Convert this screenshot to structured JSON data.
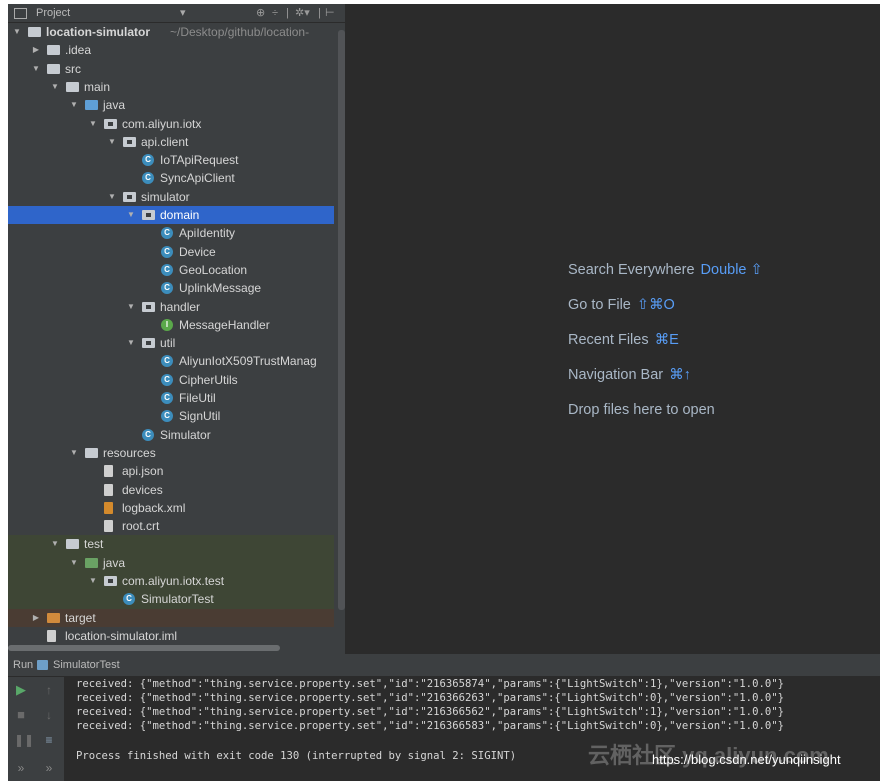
{
  "project_header": {
    "title": "Project",
    "dropdown_icon": "▾",
    "icons": [
      "target-icon",
      "split-icon",
      "gear-icon",
      "hide-icon"
    ]
  },
  "tree": [
    {
      "label": "location-simulator",
      "suffix": "~/Desktop/github/location-",
      "indent": 0,
      "toggle": "▼",
      "icon": "folder",
      "bold": true
    },
    {
      "label": ".idea",
      "indent": 1,
      "toggle": "▶",
      "icon": "folder"
    },
    {
      "label": "src",
      "indent": 1,
      "toggle": "▼",
      "icon": "folder"
    },
    {
      "label": "main",
      "indent": 2,
      "toggle": "▼",
      "icon": "folder"
    },
    {
      "label": "java",
      "indent": 3,
      "toggle": "▼",
      "icon": "folder-blue"
    },
    {
      "label": "com.aliyun.iotx",
      "indent": 4,
      "toggle": "▼",
      "icon": "package"
    },
    {
      "label": "api.client",
      "indent": 5,
      "toggle": "▼",
      "icon": "package"
    },
    {
      "label": "IoTApiRequest",
      "indent": 6,
      "icon": "class"
    },
    {
      "label": "SyncApiClient",
      "indent": 6,
      "icon": "class"
    },
    {
      "label": "simulator",
      "indent": 5,
      "toggle": "▼",
      "icon": "package"
    },
    {
      "label": "domain",
      "indent": 6,
      "toggle": "▼",
      "icon": "package",
      "selected": true
    },
    {
      "label": "ApiIdentity",
      "indent": 7,
      "icon": "class"
    },
    {
      "label": "Device",
      "indent": 7,
      "icon": "class"
    },
    {
      "label": "GeoLocation",
      "indent": 7,
      "icon": "class"
    },
    {
      "label": "UplinkMessage",
      "indent": 7,
      "icon": "class"
    },
    {
      "label": "handler",
      "indent": 6,
      "toggle": "▼",
      "icon": "package"
    },
    {
      "label": "MessageHandler",
      "indent": 7,
      "icon": "interface"
    },
    {
      "label": "util",
      "indent": 6,
      "toggle": "▼",
      "icon": "package"
    },
    {
      "label": "AliyunIotX509TrustManag",
      "indent": 7,
      "icon": "class"
    },
    {
      "label": "CipherUtils",
      "indent": 7,
      "icon": "class"
    },
    {
      "label": "FileUtil",
      "indent": 7,
      "icon": "class"
    },
    {
      "label": "SignUtil",
      "indent": 7,
      "icon": "class"
    },
    {
      "label": "Simulator",
      "indent": 6,
      "icon": "class"
    },
    {
      "label": "resources",
      "indent": 3,
      "toggle": "▼",
      "icon": "folder-res"
    },
    {
      "label": "api.json",
      "indent": 4,
      "icon": "file"
    },
    {
      "label": "devices",
      "indent": 4,
      "icon": "file"
    },
    {
      "label": "logback.xml",
      "indent": 4,
      "icon": "file-xml"
    },
    {
      "label": "root.crt",
      "indent": 4,
      "icon": "file"
    },
    {
      "label": "test",
      "indent": 2,
      "toggle": "▼",
      "icon": "folder",
      "bg": "test"
    },
    {
      "label": "java",
      "indent": 3,
      "toggle": "▼",
      "icon": "folder-green",
      "bg": "test"
    },
    {
      "label": "com.aliyun.iotx.test",
      "indent": 4,
      "toggle": "▼",
      "icon": "package",
      "bg": "test"
    },
    {
      "label": "SimulatorTest",
      "indent": 5,
      "icon": "class-test",
      "bg": "test"
    },
    {
      "label": "target",
      "indent": 1,
      "toggle": "▶",
      "icon": "folder-orange",
      "bg": "target"
    },
    {
      "label": "location-simulator.iml",
      "indent": 1,
      "icon": "file"
    }
  ],
  "editor_hints": [
    {
      "text": "Search Everywhere",
      "key": "Double ⇧"
    },
    {
      "text": "Go to File",
      "key": "⇧⌘O"
    },
    {
      "text": "Recent Files",
      "key": "⌘E"
    },
    {
      "text": "Navigation Bar",
      "key": "⌘↑"
    },
    {
      "text": "Drop files here to open",
      "key": ""
    }
  ],
  "run_panel": {
    "label": "Run",
    "config_name": "SimulatorTest",
    "lines": [
      "received: {\"method\":\"thing.service.property.set\",\"id\":\"216365874\",\"params\":{\"LightSwitch\":1},\"version\":\"1.0.0\"}",
      "received: {\"method\":\"thing.service.property.set\",\"id\":\"216366263\",\"params\":{\"LightSwitch\":0},\"version\":\"1.0.0\"}",
      "received: {\"method\":\"thing.service.property.set\",\"id\":\"216366562\",\"params\":{\"LightSwitch\":1},\"version\":\"1.0.0\"}",
      "received: {\"method\":\"thing.service.property.set\",\"id\":\"216366583\",\"params\":{\"LightSwitch\":0},\"version\":\"1.0.0\"}",
      "Process finished with exit code 130 (interrupted by signal 2: SIGINT)"
    ]
  },
  "watermark": {
    "cn": "云栖社区 yq.aliyun.com",
    "url": "https://blog.csdn.net/yunqiinsight"
  }
}
